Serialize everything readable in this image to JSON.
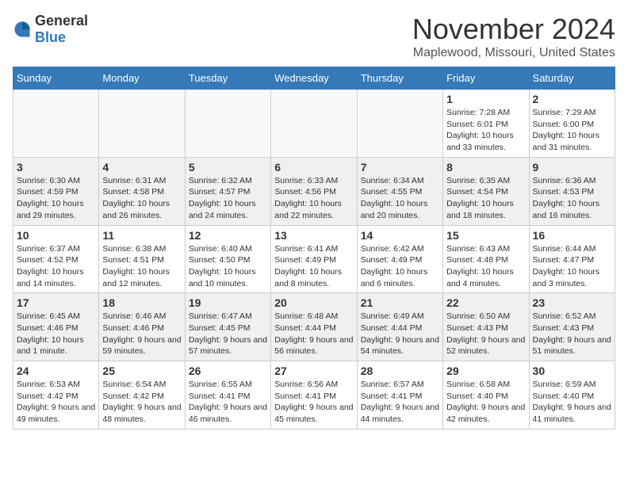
{
  "logo": {
    "text_general": "General",
    "text_blue": "Blue"
  },
  "header": {
    "month_title": "November 2024",
    "location": "Maplewood, Missouri, United States"
  },
  "days_of_week": [
    "Sunday",
    "Monday",
    "Tuesday",
    "Wednesday",
    "Thursday",
    "Friday",
    "Saturday"
  ],
  "weeks": [
    {
      "shaded": false,
      "days": [
        {
          "date": "",
          "detail": ""
        },
        {
          "date": "",
          "detail": ""
        },
        {
          "date": "",
          "detail": ""
        },
        {
          "date": "",
          "detail": ""
        },
        {
          "date": "",
          "detail": ""
        },
        {
          "date": "1",
          "detail": "Sunrise: 7:28 AM\nSunset: 6:01 PM\nDaylight: 10 hours and 33 minutes."
        },
        {
          "date": "2",
          "detail": "Sunrise: 7:29 AM\nSunset: 6:00 PM\nDaylight: 10 hours and 31 minutes."
        }
      ]
    },
    {
      "shaded": true,
      "days": [
        {
          "date": "3",
          "detail": "Sunrise: 6:30 AM\nSunset: 4:59 PM\nDaylight: 10 hours and 29 minutes."
        },
        {
          "date": "4",
          "detail": "Sunrise: 6:31 AM\nSunset: 4:58 PM\nDaylight: 10 hours and 26 minutes."
        },
        {
          "date": "5",
          "detail": "Sunrise: 6:32 AM\nSunset: 4:57 PM\nDaylight: 10 hours and 24 minutes."
        },
        {
          "date": "6",
          "detail": "Sunrise: 6:33 AM\nSunset: 4:56 PM\nDaylight: 10 hours and 22 minutes."
        },
        {
          "date": "7",
          "detail": "Sunrise: 6:34 AM\nSunset: 4:55 PM\nDaylight: 10 hours and 20 minutes."
        },
        {
          "date": "8",
          "detail": "Sunrise: 6:35 AM\nSunset: 4:54 PM\nDaylight: 10 hours and 18 minutes."
        },
        {
          "date": "9",
          "detail": "Sunrise: 6:36 AM\nSunset: 4:53 PM\nDaylight: 10 hours and 16 minutes."
        }
      ]
    },
    {
      "shaded": false,
      "days": [
        {
          "date": "10",
          "detail": "Sunrise: 6:37 AM\nSunset: 4:52 PM\nDaylight: 10 hours and 14 minutes."
        },
        {
          "date": "11",
          "detail": "Sunrise: 6:38 AM\nSunset: 4:51 PM\nDaylight: 10 hours and 12 minutes."
        },
        {
          "date": "12",
          "detail": "Sunrise: 6:40 AM\nSunset: 4:50 PM\nDaylight: 10 hours and 10 minutes."
        },
        {
          "date": "13",
          "detail": "Sunrise: 6:41 AM\nSunset: 4:49 PM\nDaylight: 10 hours and 8 minutes."
        },
        {
          "date": "14",
          "detail": "Sunrise: 6:42 AM\nSunset: 4:49 PM\nDaylight: 10 hours and 6 minutes."
        },
        {
          "date": "15",
          "detail": "Sunrise: 6:43 AM\nSunset: 4:48 PM\nDaylight: 10 hours and 4 minutes."
        },
        {
          "date": "16",
          "detail": "Sunrise: 6:44 AM\nSunset: 4:47 PM\nDaylight: 10 hours and 3 minutes."
        }
      ]
    },
    {
      "shaded": true,
      "days": [
        {
          "date": "17",
          "detail": "Sunrise: 6:45 AM\nSunset: 4:46 PM\nDaylight: 10 hours and 1 minute."
        },
        {
          "date": "18",
          "detail": "Sunrise: 6:46 AM\nSunset: 4:46 PM\nDaylight: 9 hours and 59 minutes."
        },
        {
          "date": "19",
          "detail": "Sunrise: 6:47 AM\nSunset: 4:45 PM\nDaylight: 9 hours and 57 minutes."
        },
        {
          "date": "20",
          "detail": "Sunrise: 6:48 AM\nSunset: 4:44 PM\nDaylight: 9 hours and 56 minutes."
        },
        {
          "date": "21",
          "detail": "Sunrise: 6:49 AM\nSunset: 4:44 PM\nDaylight: 9 hours and 54 minutes."
        },
        {
          "date": "22",
          "detail": "Sunrise: 6:50 AM\nSunset: 4:43 PM\nDaylight: 9 hours and 52 minutes."
        },
        {
          "date": "23",
          "detail": "Sunrise: 6:52 AM\nSunset: 4:43 PM\nDaylight: 9 hours and 51 minutes."
        }
      ]
    },
    {
      "shaded": false,
      "days": [
        {
          "date": "24",
          "detail": "Sunrise: 6:53 AM\nSunset: 4:42 PM\nDaylight: 9 hours and 49 minutes."
        },
        {
          "date": "25",
          "detail": "Sunrise: 6:54 AM\nSunset: 4:42 PM\nDaylight: 9 hours and 48 minutes."
        },
        {
          "date": "26",
          "detail": "Sunrise: 6:55 AM\nSunset: 4:41 PM\nDaylight: 9 hours and 46 minutes."
        },
        {
          "date": "27",
          "detail": "Sunrise: 6:56 AM\nSunset: 4:41 PM\nDaylight: 9 hours and 45 minutes."
        },
        {
          "date": "28",
          "detail": "Sunrise: 6:57 AM\nSunset: 4:41 PM\nDaylight: 9 hours and 44 minutes."
        },
        {
          "date": "29",
          "detail": "Sunrise: 6:58 AM\nSunset: 4:40 PM\nDaylight: 9 hours and 42 minutes."
        },
        {
          "date": "30",
          "detail": "Sunrise: 6:59 AM\nSunset: 4:40 PM\nDaylight: 9 hours and 41 minutes."
        }
      ]
    }
  ]
}
